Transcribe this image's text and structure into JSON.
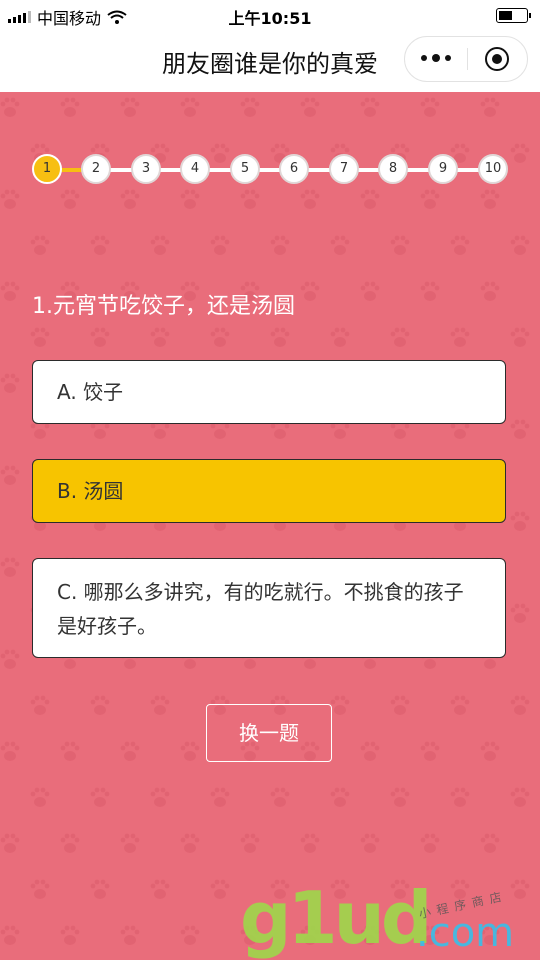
{
  "status_bar": {
    "carrier": "中国移动",
    "time": "上午10:51"
  },
  "nav": {
    "title": "朋友圈谁是你的真爱",
    "more_icon": "more-dots-icon",
    "close_icon": "target-circle-icon"
  },
  "progress": {
    "current": 1,
    "steps": [
      "1",
      "2",
      "3",
      "4",
      "5",
      "6",
      "7",
      "8",
      "9",
      "10"
    ]
  },
  "question": {
    "text": "1.元宵节吃饺子，还是汤圆",
    "options": [
      {
        "label": "A. 饺子",
        "selected": false
      },
      {
        "label": "B. 汤圆",
        "selected": true
      },
      {
        "label": "C. 哪那么多讲究，有的吃就行。不挑食的孩子是好孩子。",
        "selected": false
      }
    ]
  },
  "change_button": "换一题",
  "watermark": {
    "main": "g1ud",
    "domain": ".com",
    "sub": "小程序商店"
  },
  "colors": {
    "background": "#e96d7b",
    "accent": "#f7c400",
    "progress_done": "#f7bf12",
    "white": "#ffffff"
  }
}
